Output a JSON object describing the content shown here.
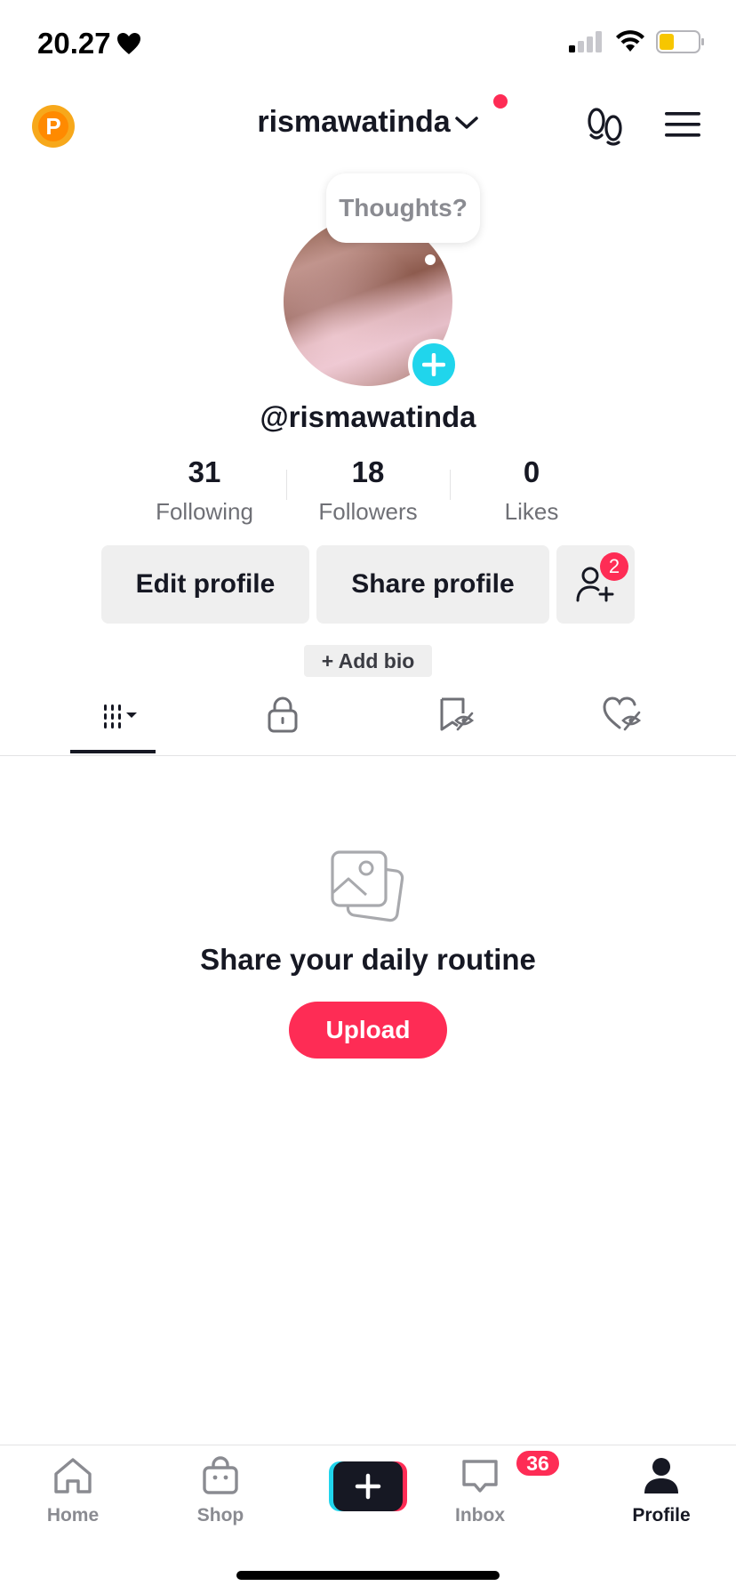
{
  "status_bar": {
    "time": "20.27",
    "heart_icon": "heart-icon"
  },
  "header": {
    "coin_label": "P",
    "username": "rismawatinda",
    "accent_dot_color": "#fe2c55"
  },
  "profile": {
    "thought_bubble": "Thoughts?",
    "handle": "@rismawatinda",
    "stats": [
      {
        "value": "31",
        "label": "Following"
      },
      {
        "value": "18",
        "label": "Followers"
      },
      {
        "value": "0",
        "label": "Likes"
      }
    ],
    "edit_button": "Edit profile",
    "share_button": "Share profile",
    "friend_requests_badge": "2",
    "add_bio": "+ Add bio"
  },
  "tabs": [
    {
      "icon": "grid-icon",
      "active": true
    },
    {
      "icon": "lock-icon",
      "active": false
    },
    {
      "icon": "bookmark-hidden-icon",
      "active": false
    },
    {
      "icon": "heart-hidden-icon",
      "active": false
    }
  ],
  "empty_state": {
    "title": "Share your daily routine",
    "upload_label": "Upload"
  },
  "bottom_nav": {
    "items": [
      {
        "label": "Home",
        "icon": "home-icon"
      },
      {
        "label": "Shop",
        "icon": "shop-bag-icon"
      },
      {
        "label": "",
        "icon": "plus-icon"
      },
      {
        "label": "Inbox",
        "icon": "inbox-icon"
      },
      {
        "label": "Profile",
        "icon": "profile-icon"
      }
    ],
    "inbox_badge": "36"
  },
  "colors": {
    "accent": "#fe2c55",
    "teal": "#20d5ec",
    "text": "#161823"
  }
}
